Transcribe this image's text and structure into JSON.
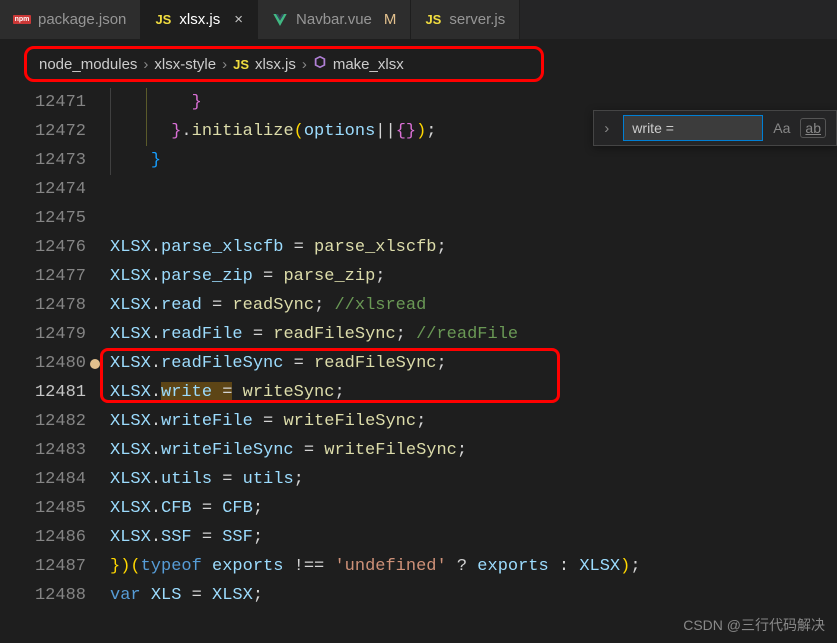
{
  "tabs": [
    {
      "icon": "npm",
      "label": "package.json",
      "active": false
    },
    {
      "icon": "js",
      "label": "xlsx.js",
      "active": true,
      "close": "×"
    },
    {
      "icon": "vue",
      "label": "Navbar.vue",
      "modified": "M",
      "active": false
    },
    {
      "icon": "js",
      "label": "server.js",
      "active": false
    }
  ],
  "breadcrumb": {
    "seg1": "node_modules",
    "seg2": "xlsx-style",
    "seg3": "xlsx.js",
    "seg4": "make_xlsx",
    "sep": "›"
  },
  "search": {
    "value": "write =",
    "case": "Aa",
    "word": "ab"
  },
  "line_numbers": [
    "12471",
    "12472",
    "12473",
    "12474",
    "12475",
    "12476",
    "12477",
    "12478",
    "12479",
    "12480",
    "12481",
    "12482",
    "12483",
    "12484",
    "12485",
    "12486",
    "12487",
    "12488"
  ],
  "current_line_index": 10,
  "code": {
    "l0": {
      "indent": "        ",
      "brace": "}"
    },
    "l1": {
      "indent": "      ",
      "brace": "}",
      "dot": ".",
      "fn": "initialize",
      "p1": "(",
      "arg": "options",
      "or": "||",
      "obj": "{}",
      "p2": ")",
      "semi": ";"
    },
    "l2": {
      "indent": "    ",
      "brace": "}"
    },
    "l5": {
      "obj": "XLSX",
      "dot": ".",
      "prop": "parse_xlscfb",
      "eq": " = ",
      "val": "parse_xlscfb",
      "semi": ";"
    },
    "l6": {
      "obj": "XLSX",
      "dot": ".",
      "prop": "parse_zip",
      "eq": " = ",
      "val": "parse_zip",
      "semi": ";"
    },
    "l7": {
      "obj": "XLSX",
      "dot": ".",
      "prop": "read",
      "eq": " = ",
      "val": "readSync",
      "semi": ";",
      "comment": " //xlsread"
    },
    "l8": {
      "obj": "XLSX",
      "dot": ".",
      "prop": "readFile",
      "eq": " = ",
      "val": "readFileSync",
      "semi": ";",
      "comment": " //readFile"
    },
    "l9": {
      "obj": "XLSX",
      "dot": ".",
      "prop": "readFileSync",
      "eq": " = ",
      "val": "readFileSync",
      "semi": ";"
    },
    "l10": {
      "obj": "XLSX",
      "dot": ".",
      "prop": "write",
      "eq": " =",
      "sp": " ",
      "val": "writeSync",
      "semi": ";"
    },
    "l11": {
      "obj": "XLSX",
      "dot": ".",
      "prop": "writeFile",
      "eq": " = ",
      "val": "writeFileSync",
      "semi": ";"
    },
    "l12": {
      "obj": "XLSX",
      "dot": ".",
      "prop": "writeFileSync",
      "eq": " = ",
      "val": "writeFileSync",
      "semi": ";"
    },
    "l13": {
      "obj": "XLSX",
      "dot": ".",
      "prop": "utils",
      "eq": " = ",
      "val": "utils",
      "semi": ";"
    },
    "l14": {
      "obj": "XLSX",
      "dot": ".",
      "prop": "CFB",
      "eq": " = ",
      "val": "CFB",
      "semi": ";"
    },
    "l15": {
      "obj": "XLSX",
      "dot": ".",
      "prop": "SSF",
      "eq": " = ",
      "val": "SSF",
      "semi": ";"
    },
    "l16": {
      "b1": "}",
      "p1": ")",
      "p2": "(",
      "kw": "typeof",
      "sp": " ",
      "v1": "exports",
      "neq": " !== ",
      "str": "'undefined'",
      "q": " ? ",
      "v2": "exports",
      "c": " : ",
      "v3": "XLSX",
      "p3": ")",
      "semi": ";"
    },
    "l17": {
      "kw": "var",
      "sp": " ",
      "v": "XLS",
      "eq": " = ",
      "val": "XLSX",
      "semi": ";"
    }
  },
  "watermark": "CSDN @三行代码解决"
}
